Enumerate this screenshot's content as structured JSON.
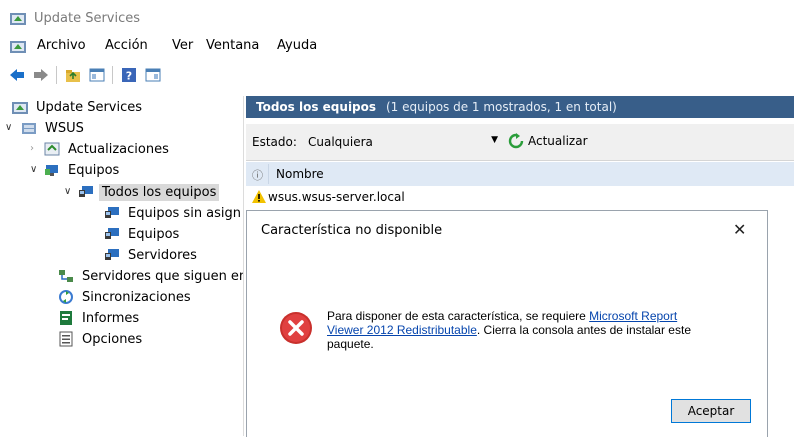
{
  "window": {
    "title": "Update Services"
  },
  "menu": {
    "items": [
      "Archivo",
      "Acción",
      "Ver",
      "Ventana",
      "Ayuda"
    ]
  },
  "tree": {
    "root": "Update Services",
    "server": "WSUS",
    "updates": "Actualizaciones",
    "computers": "Equipos",
    "all_computers": "Todos los equipos",
    "unassigned": "Equipos sin asign",
    "group_computers": "Equipos",
    "group_servers": "Servidores",
    "downstream": "Servidores que siguen en",
    "syncs": "Sincronizaciones",
    "reports": "Informes",
    "options": "Opciones"
  },
  "panel": {
    "title": "Todos los equipos",
    "subtitle": "(1 equipos de 1 mostrados, 1 en total)",
    "status_label": "Estado:",
    "status_value": "Cualquiera",
    "refresh_label": "Actualizar",
    "col_info": "ⓘ",
    "col_name": "Nombre",
    "rows": [
      {
        "name": "wsus.wsus-server.local",
        "status": "warning"
      }
    ]
  },
  "dialog": {
    "title": "Característica no disponible",
    "close_glyph": "✕",
    "msg_prefix": "Para disponer de esta característica, se requiere ",
    "link_line1": "Microsoft Report",
    "link_line2": "Viewer 2012 Redistributable",
    "msg_suffix": ". Cierra la consola antes de instalar este",
    "msg_line3": "paquete.",
    "ok_label": "Aceptar",
    "icon": "error-icon"
  },
  "colors": {
    "header_bg": "#385e89",
    "column_header_bg": "#dfe9f5",
    "error_red": "#d32f2f",
    "link": "#0645ad"
  }
}
